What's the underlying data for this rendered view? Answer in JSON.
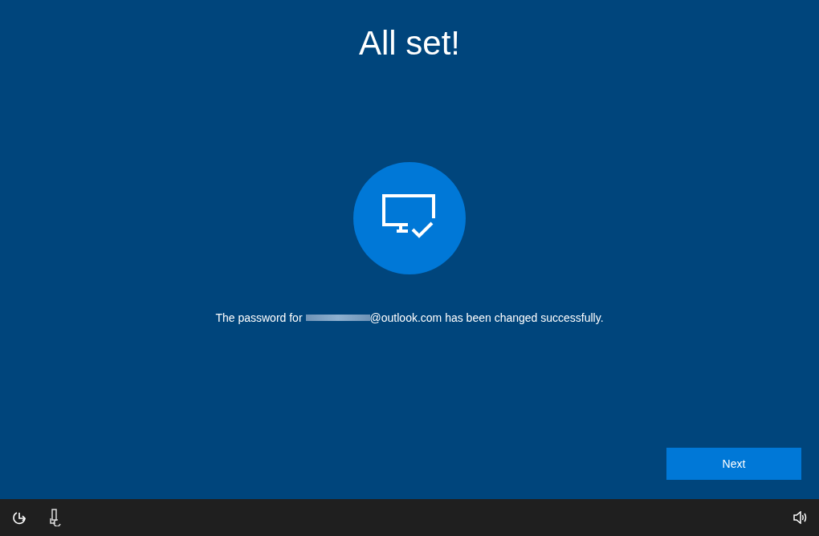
{
  "title": "All set!",
  "message": {
    "before": "The password for",
    "redacted": true,
    "after": "@outlook.com has been changed successfully."
  },
  "buttons": [
    {
      "label": "Next",
      "kind": "primary"
    }
  ],
  "taskbar": [
    {
      "kind": "ease-of-access"
    },
    {
      "kind": "language"
    },
    {
      "kind": "volume"
    }
  ]
}
